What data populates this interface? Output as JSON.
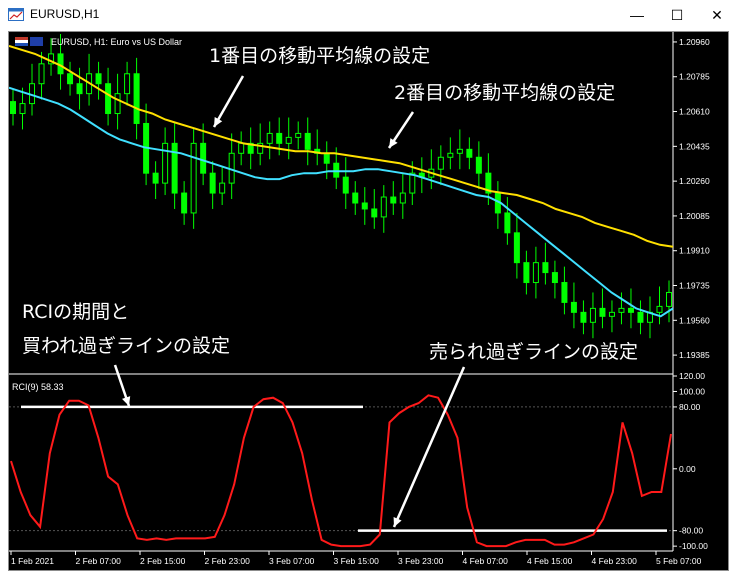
{
  "window": {
    "title": "EURUSD,H1",
    "minimize_glyph": "—",
    "maximize_glyph": "☐",
    "close_glyph": "✕"
  },
  "chart": {
    "symbol_label": "EURUSD, H1:  Euro vs US Dollar",
    "indicator_label": "RCI(9) 58.33"
  },
  "annotations": {
    "ma1": "1番目の移動平均線の設定",
    "ma2": "2番目の移動平均線の設定",
    "rci_period_line1": "RCIの期間と",
    "rci_period_line2": "買われ過ぎラインの設定",
    "oversold": "売られ過ぎラインの設定"
  },
  "colors": {
    "background": "#000000",
    "bull_candle": "#00ff00",
    "bear_candle": "#00ff00",
    "ma_fast": "#40e0ff",
    "ma_slow": "#ffe000",
    "rci": "#ff1a1a",
    "level_lines": "#ffffff",
    "axis_text": "#ffffff"
  },
  "chart_data": [
    {
      "type": "candlestick",
      "symbol": "EURUSD",
      "timeframe": "H1",
      "y_tick_labels": [
        "1.20960",
        "1.20785",
        "1.20610",
        "1.20435",
        "1.20260",
        "1.20085",
        "1.19910",
        "1.19735",
        "1.19560",
        "1.19385"
      ],
      "ylim": [
        1.193,
        1.21
      ],
      "x_tick_labels": [
        "1 Feb 2021",
        "2 Feb 07:00",
        "2 Feb 15:00",
        "2 Feb 23:00",
        "3 Feb 07:00",
        "3 Feb 15:00",
        "3 Feb 23:00",
        "4 Feb 07:00",
        "4 Feb 15:00",
        "4 Feb 23:00",
        "5 Feb 07:00"
      ],
      "closes": [
        1.206,
        1.2065,
        1.2075,
        1.2085,
        1.209,
        1.208,
        1.2075,
        1.207,
        1.208,
        1.2075,
        1.206,
        1.207,
        1.208,
        1.2055,
        1.203,
        1.2025,
        1.2045,
        1.202,
        1.201,
        1.2045,
        1.203,
        1.202,
        1.2025,
        1.204,
        1.2045,
        1.204,
        1.2045,
        1.205,
        1.2045,
        1.2048,
        1.205,
        1.2042,
        1.204,
        1.2035,
        1.2028,
        1.202,
        1.2015,
        1.2012,
        1.2008,
        1.2018,
        1.2015,
        1.202,
        1.203,
        1.2028,
        1.2032,
        1.2038,
        1.204,
        1.2042,
        1.2038,
        1.203,
        1.202,
        1.201,
        1.2,
        1.1985,
        1.1975,
        1.1985,
        1.198,
        1.1975,
        1.1965,
        1.196,
        1.1955,
        1.1962,
        1.1958,
        1.196,
        1.1962,
        1.196,
        1.1955,
        1.196,
        1.1963,
        1.197
      ],
      "series": [
        {
          "name": "",
          "kind": "ma_fast",
          "values": [
            1.2073,
            1.2071,
            1.2069,
            1.2067,
            1.2065,
            1.2062,
            1.2058,
            1.2054,
            1.205,
            1.2047,
            1.2045,
            1.2043,
            1.2042,
            1.2041,
            1.204,
            1.2038,
            1.2036,
            1.2034,
            1.2032,
            1.203,
            1.2028,
            1.2027,
            1.2027,
            1.2029,
            1.203,
            1.203,
            1.2031,
            1.2031,
            1.2031,
            1.2032,
            1.2032,
            1.2031,
            1.203,
            1.2029,
            1.2027,
            1.2025,
            1.2023,
            1.2021,
            1.2019,
            1.2018,
            1.2015,
            1.201,
            1.2005,
            1.2,
            1.1995,
            1.199,
            1.1985,
            1.198,
            1.1975,
            1.197,
            1.1966,
            1.1962,
            1.196,
            1.1958,
            1.1962
          ]
        },
        {
          "name": "",
          "kind": "ma_slow",
          "values": [
            1.2094,
            1.2092,
            1.209,
            1.2087,
            1.2084,
            1.208,
            1.2076,
            1.2072,
            1.2068,
            1.2065,
            1.2062,
            1.206,
            1.2057,
            1.2055,
            1.2053,
            1.2051,
            1.2049,
            1.2047,
            1.2045,
            1.2044,
            1.2043,
            1.2042,
            1.2041,
            1.2041,
            1.204,
            1.204,
            1.2039,
            1.2038,
            1.2037,
            1.2036,
            1.2035,
            1.2033,
            1.2031,
            1.2029,
            1.2027,
            1.2025,
            1.2023,
            1.2021,
            1.202,
            1.2019,
            1.2017,
            1.2015,
            1.2012,
            1.201,
            1.2008,
            1.2005,
            1.2003,
            1.2001,
            1.1999,
            1.1996,
            1.1994,
            1.1993
          ]
        }
      ]
    },
    {
      "type": "line",
      "name": "RCI(9)",
      "y_tick_labels": [
        "120.00",
        "100.00",
        "80.00",
        "0.00",
        "-80.00",
        "-100.00"
      ],
      "ylim": [
        -105,
        120
      ],
      "levels": [
        80,
        -80
      ],
      "values": [
        10,
        -30,
        -60,
        -75,
        20,
        70,
        88,
        88,
        82,
        40,
        -10,
        -20,
        -60,
        -90,
        -92,
        -90,
        -92,
        -90,
        -90,
        -90,
        -90,
        -88,
        -60,
        -20,
        40,
        80,
        90,
        92,
        85,
        60,
        20,
        -40,
        -92,
        -98,
        -100,
        -100,
        -100,
        -98,
        -85,
        60,
        72,
        80,
        85,
        95,
        92,
        70,
        40,
        -50,
        -95,
        -100,
        -100,
        -100,
        -95,
        -92,
        -92,
        -92,
        -98,
        -98,
        -95,
        -90,
        -85,
        -65,
        -30,
        60,
        20,
        -35,
        -30,
        -30,
        45
      ],
      "current_value": 58.33
    }
  ]
}
